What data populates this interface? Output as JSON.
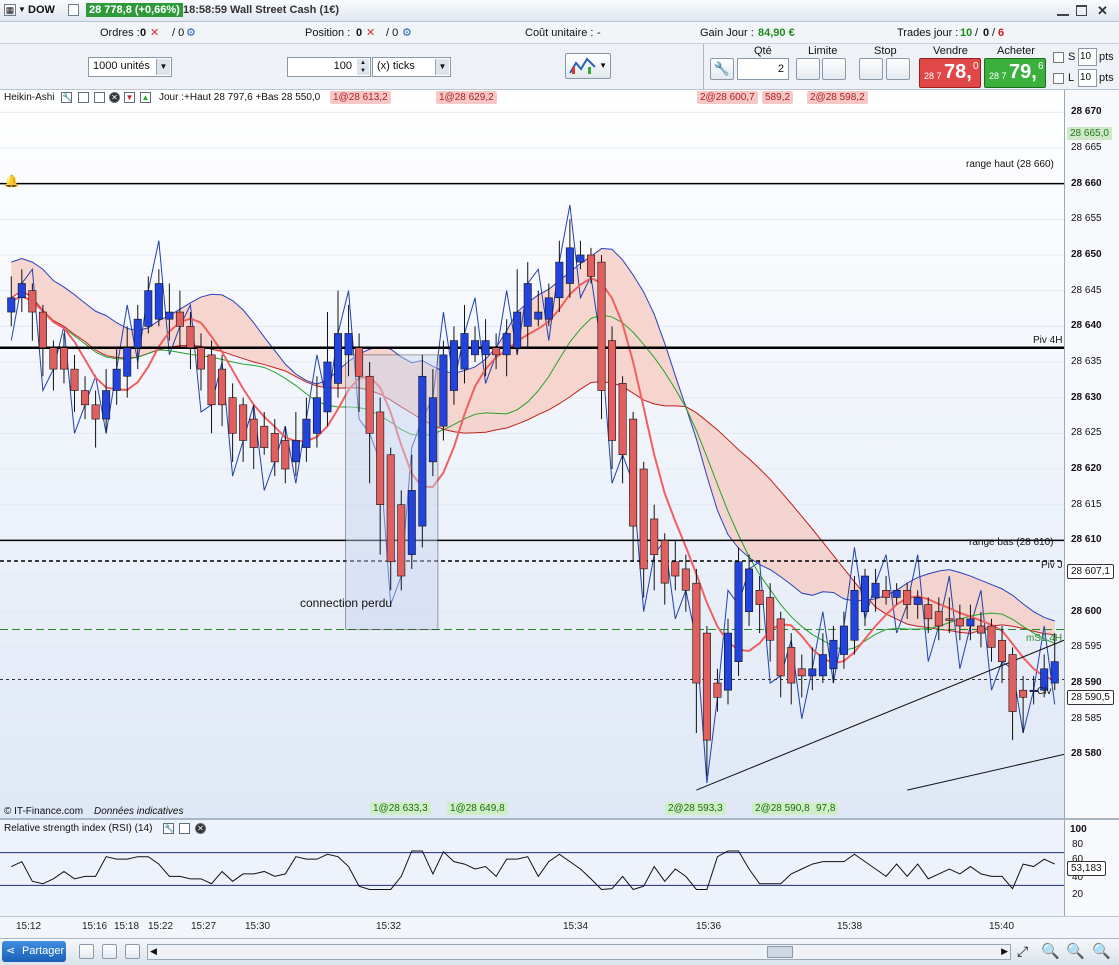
{
  "titlebar": {
    "instrument": "DOW",
    "price_badge": "28 778,8 (+0,66%)",
    "time": "18:58:59",
    "description": "Wall Street Cash (1€)"
  },
  "infobar": {
    "orders_label": "Ordres :",
    "orders_value": "0",
    "orders_value2": "/ 0",
    "position_label": "Position :",
    "position_value": "0",
    "position_value2": "/ 0",
    "unit_cost_label": "Coût unitaire :",
    "unit_cost_value": "-",
    "gain_label": "Gain Jour :",
    "gain_value": "84,90 €",
    "trades_label": "Trades jour :",
    "trades_value_green": "10",
    "trades_sep1": "/",
    "trades_value_mid": "0",
    "trades_sep2": "/",
    "trades_value_red": "6"
  },
  "toolbar": {
    "units_select": "1000 unités",
    "qty_input": "100",
    "ticks_select": "(x) ticks",
    "col_qty": "Qté",
    "qty_value": "2",
    "col_limit": "Limite",
    "col_stop": "Stop",
    "col_sell": "Vendre",
    "col_buy": "Acheter",
    "sell_prefix": "28 7",
    "sell_big": "78,",
    "sell_sup": "0",
    "buy_prefix": "28 7",
    "buy_big": "79,",
    "buy_sup": "6",
    "s_label": "S",
    "l_label": "L",
    "pts_value": "10",
    "pts_label": "pts"
  },
  "chart": {
    "indicator_name": "Heikin-Ashi",
    "day_info": "Jour :+Haut 28 797,6 +Bas 28 550,0",
    "top_tags": [
      "1@28 613,2",
      "1@28 629,2",
      "2@28 600,7",
      "589,2",
      "2@28 598,2"
    ],
    "bottom_tags": [
      "1@28 633,3",
      "1@28 649,8",
      "2@28 593,3",
      "2@28 590,8",
      "97,8"
    ],
    "line_labels": {
      "range_haut": "range haut (28 660)",
      "range_bas": "range bas (28 610)",
      "piv4h": "Piv 4H",
      "piv_j": "Piv J",
      "ms1": "mS1 4H",
      "clv": "Clv"
    },
    "annotation": "connection perdu",
    "footer": "© IT-Finance.com",
    "footer_italic": "Données indicatives",
    "price_box_top": "28 665,0",
    "price_box_piv": "28 607,1",
    "price_box_last": "28 590,5",
    "y_ticks": [
      "28 670",
      "28 665",
      "28 660",
      "28 655",
      "28 650",
      "28 645",
      "28 640",
      "28 635",
      "28 630",
      "28 625",
      "28 620",
      "28 615",
      "28 610",
      "28 605",
      "28 600",
      "28 595",
      "28 590",
      "28 585",
      "28 580"
    ]
  },
  "chart_data": {
    "type": "candlestick",
    "ylim": [
      28576,
      28672
    ],
    "candles": [
      {
        "o": 28642,
        "c": 28644,
        "h": 28647,
        "l": 28640,
        "up": true
      },
      {
        "o": 28644,
        "c": 28646,
        "h": 28648,
        "l": 28642,
        "up": true
      },
      {
        "o": 28645,
        "c": 28642,
        "h": 28646,
        "l": 28638,
        "up": false
      },
      {
        "o": 28642,
        "c": 28637,
        "h": 28643,
        "l": 28633,
        "up": false
      },
      {
        "o": 28637,
        "c": 28634,
        "h": 28638,
        "l": 28631,
        "up": false
      },
      {
        "o": 28637,
        "c": 28634,
        "h": 28639,
        "l": 28632,
        "up": false
      },
      {
        "o": 28634,
        "c": 28631,
        "h": 28636,
        "l": 28628,
        "up": false
      },
      {
        "o": 28631,
        "c": 28629,
        "h": 28633,
        "l": 28627,
        "up": false
      },
      {
        "o": 28629,
        "c": 28627,
        "h": 28631,
        "l": 28623,
        "up": false
      },
      {
        "o": 28627,
        "c": 28631,
        "h": 28634,
        "l": 28625,
        "up": true
      },
      {
        "o": 28631,
        "c": 28634,
        "h": 28637,
        "l": 28629,
        "up": true
      },
      {
        "o": 28633,
        "c": 28637,
        "h": 28640,
        "l": 28630,
        "up": true
      },
      {
        "o": 28637,
        "c": 28641,
        "h": 28643,
        "l": 28634,
        "up": true
      },
      {
        "o": 28640,
        "c": 28645,
        "h": 28647,
        "l": 28639,
        "up": true
      },
      {
        "o": 28641,
        "c": 28646,
        "h": 28648,
        "l": 28640,
        "up": true
      },
      {
        "o": 28641,
        "c": 28642,
        "h": 28646,
        "l": 28638,
        "up": true
      },
      {
        "o": 28642,
        "c": 28640,
        "h": 28645,
        "l": 28637,
        "up": false
      },
      {
        "o": 28640,
        "c": 28637,
        "h": 28642,
        "l": 28634,
        "up": false
      },
      {
        "o": 28637,
        "c": 28634,
        "h": 28639,
        "l": 28631,
        "up": false
      },
      {
        "o": 28636,
        "c": 28629,
        "h": 28638,
        "l": 28625,
        "up": false
      },
      {
        "o": 28634,
        "c": 28629,
        "h": 28636,
        "l": 28626,
        "up": false
      },
      {
        "o": 28630,
        "c": 28625,
        "h": 28632,
        "l": 28621,
        "up": false
      },
      {
        "o": 28629,
        "c": 28624,
        "h": 28630,
        "l": 28621,
        "up": false
      },
      {
        "o": 28627,
        "c": 28623,
        "h": 28629,
        "l": 28620,
        "up": false
      },
      {
        "o": 28626,
        "c": 28623,
        "h": 28628,
        "l": 28622,
        "up": false
      },
      {
        "o": 28625,
        "c": 28621,
        "h": 28627,
        "l": 28619,
        "up": false
      },
      {
        "o": 28624,
        "c": 28620,
        "h": 28626,
        "l": 28618,
        "up": false
      },
      {
        "o": 28621,
        "c": 28624,
        "h": 28628,
        "l": 28619,
        "up": true
      },
      {
        "o": 28623,
        "c": 28627,
        "h": 28630,
        "l": 28621,
        "up": true
      },
      {
        "o": 28625,
        "c": 28630,
        "h": 28633,
        "l": 28623,
        "up": true
      },
      {
        "o": 28628,
        "c": 28635,
        "h": 28642,
        "l": 28626,
        "up": true
      },
      {
        "o": 28632,
        "c": 28639,
        "h": 28645,
        "l": 28630,
        "up": true
      },
      {
        "o": 28636,
        "c": 28639,
        "h": 28643,
        "l": 28633,
        "up": true
      },
      {
        "o": 28637,
        "c": 28633,
        "h": 28639,
        "l": 28628,
        "up": false
      },
      {
        "o": 28633,
        "c": 28625,
        "h": 28635,
        "l": 28618,
        "up": false
      },
      {
        "o": 28628,
        "c": 28615,
        "h": 28630,
        "l": 28608,
        "up": false
      },
      {
        "o": 28622,
        "c": 28607,
        "h": 28623,
        "l": 28603,
        "up": false
      },
      {
        "o": 28615,
        "c": 28605,
        "h": 28617,
        "l": 28603,
        "up": false
      },
      {
        "o": 28608,
        "c": 28617,
        "h": 28622,
        "l": 28606,
        "up": true
      },
      {
        "o": 28612,
        "c": 28633,
        "h": 28636,
        "l": 28609,
        "up": true
      },
      {
        "o": 28621,
        "c": 28630,
        "h": 28634,
        "l": 28619,
        "up": true
      },
      {
        "o": 28626,
        "c": 28636,
        "h": 28638,
        "l": 28624,
        "up": true
      },
      {
        "o": 28631,
        "c": 28638,
        "h": 28640,
        "l": 28629,
        "up": true
      },
      {
        "o": 28634,
        "c": 28639,
        "h": 28643,
        "l": 28632,
        "up": true
      },
      {
        "o": 28636,
        "c": 28638,
        "h": 28640,
        "l": 28635,
        "up": true
      },
      {
        "o": 28636,
        "c": 28638,
        "h": 28641,
        "l": 28633,
        "up": true
      },
      {
        "o": 28637,
        "c": 28636,
        "h": 28639,
        "l": 28634,
        "up": false
      },
      {
        "o": 28636,
        "c": 28639,
        "h": 28641,
        "l": 28633,
        "up": true
      },
      {
        "o": 28637,
        "c": 28642,
        "h": 28648,
        "l": 28636,
        "up": true
      },
      {
        "o": 28640,
        "c": 28646,
        "h": 28649,
        "l": 28637,
        "up": true
      },
      {
        "o": 28641,
        "c": 28642,
        "h": 28645,
        "l": 28640,
        "up": true
      },
      {
        "o": 28641,
        "c": 28644,
        "h": 28646,
        "l": 28640,
        "up": true
      },
      {
        "o": 28644,
        "c": 28649,
        "h": 28652,
        "l": 28642,
        "up": true
      },
      {
        "o": 28646,
        "c": 28651,
        "h": 28655,
        "l": 28644,
        "up": true
      },
      {
        "o": 28649,
        "c": 28650,
        "h": 28652,
        "l": 28648,
        "up": true
      },
      {
        "o": 28650,
        "c": 28647,
        "h": 28651,
        "l": 28646,
        "up": false
      },
      {
        "o": 28649,
        "c": 28631,
        "h": 28650,
        "l": 28627,
        "up": false
      },
      {
        "o": 28638,
        "c": 28624,
        "h": 28640,
        "l": 28620,
        "up": false
      },
      {
        "o": 28632,
        "c": 28622,
        "h": 28633,
        "l": 28618,
        "up": false
      },
      {
        "o": 28627,
        "c": 28612,
        "h": 28628,
        "l": 28607,
        "up": false
      },
      {
        "o": 28620,
        "c": 28606,
        "h": 28621,
        "l": 28602,
        "up": false
      },
      {
        "o": 28613,
        "c": 28608,
        "h": 28615,
        "l": 28603,
        "up": false
      },
      {
        "o": 28610,
        "c": 28604,
        "h": 28611,
        "l": 28601,
        "up": false
      },
      {
        "o": 28607,
        "c": 28605,
        "h": 28610,
        "l": 28603,
        "up": false
      },
      {
        "o": 28606,
        "c": 28603,
        "h": 28608,
        "l": 28600,
        "up": false
      },
      {
        "o": 28604,
        "c": 28590,
        "h": 28606,
        "l": 28583,
        "up": false
      },
      {
        "o": 28597,
        "c": 28582,
        "h": 28598,
        "l": 28577,
        "up": false
      },
      {
        "o": 28590,
        "c": 28588,
        "h": 28592,
        "l": 28586,
        "up": false
      },
      {
        "o": 28589,
        "c": 28597,
        "h": 28599,
        "l": 28587,
        "up": true
      },
      {
        "o": 28593,
        "c": 28607,
        "h": 28609,
        "l": 28591,
        "up": true
      },
      {
        "o": 28600,
        "c": 28606,
        "h": 28608,
        "l": 28598,
        "up": true
      },
      {
        "o": 28603,
        "c": 28601,
        "h": 28605,
        "l": 28597,
        "up": false
      },
      {
        "o": 28602,
        "c": 28596,
        "h": 28604,
        "l": 28593,
        "up": false
      },
      {
        "o": 28599,
        "c": 28591,
        "h": 28600,
        "l": 28588,
        "up": false
      },
      {
        "o": 28595,
        "c": 28590,
        "h": 28597,
        "l": 28587,
        "up": false
      },
      {
        "o": 28592,
        "c": 28591,
        "h": 28594,
        "l": 28588,
        "up": false
      },
      {
        "o": 28591,
        "c": 28592,
        "h": 28595,
        "l": 28589,
        "up": true
      },
      {
        "o": 28591,
        "c": 28594,
        "h": 28597,
        "l": 28590,
        "up": true
      },
      {
        "o": 28592,
        "c": 28596,
        "h": 28598,
        "l": 28590,
        "up": true
      },
      {
        "o": 28594,
        "c": 28598,
        "h": 28600,
        "l": 28592,
        "up": true
      },
      {
        "o": 28596,
        "c": 28603,
        "h": 28605,
        "l": 28594,
        "up": true
      },
      {
        "o": 28600,
        "c": 28605,
        "h": 28606,
        "l": 28598,
        "up": true
      },
      {
        "o": 28602,
        "c": 28604,
        "h": 28606,
        "l": 28600,
        "up": true
      },
      {
        "o": 28603,
        "c": 28602,
        "h": 28605,
        "l": 28601,
        "up": false
      },
      {
        "o": 28602,
        "c": 28603,
        "h": 28604,
        "l": 28601,
        "up": true
      },
      {
        "o": 28603,
        "c": 28601,
        "h": 28604,
        "l": 28599,
        "up": false
      },
      {
        "o": 28601,
        "c": 28602,
        "h": 28603,
        "l": 28599,
        "up": true
      },
      {
        "o": 28601,
        "c": 28599,
        "h": 28602,
        "l": 28597,
        "up": false
      },
      {
        "o": 28600,
        "c": 28598,
        "h": 28602,
        "l": 28596,
        "up": false
      },
      {
        "o": 28599,
        "c": 28599,
        "h": 28602,
        "l": 28597,
        "up": false
      },
      {
        "o": 28599,
        "c": 28598,
        "h": 28601,
        "l": 28596,
        "up": false
      },
      {
        "o": 28599,
        "c": 28598,
        "h": 28601,
        "l": 28596,
        "up": true
      },
      {
        "o": 28598,
        "c": 28597,
        "h": 28600,
        "l": 28595,
        "up": false
      },
      {
        "o": 28598,
        "c": 28595,
        "h": 28599,
        "l": 28593,
        "up": false
      },
      {
        "o": 28596,
        "c": 28593,
        "h": 28598,
        "l": 28590,
        "up": false
      },
      {
        "o": 28594,
        "c": 28586,
        "h": 28595,
        "l": 28582,
        "up": false
      },
      {
        "o": 28588,
        "c": 28589,
        "h": 28591,
        "l": 28583,
        "up": false
      },
      {
        "o": 28589,
        "c": 28589,
        "h": 28591,
        "l": 28587,
        "up": true
      },
      {
        "o": 28589,
        "c": 28592,
        "h": 28594,
        "l": 28588,
        "up": true
      },
      {
        "o": 28590,
        "c": 28593,
        "h": 28597,
        "l": 28589,
        "up": true
      }
    ],
    "rsi": {
      "name": "Relative strength index (RSI) (14)",
      "ylim": [
        0,
        100
      ],
      "ticks": [
        "100",
        "80",
        "60",
        "40",
        "20"
      ],
      "last": "53,183"
    },
    "time_labels": [
      "15:12",
      "15:16",
      "15:18",
      "15:22",
      "15:27",
      "15:30",
      "15:32",
      "15:34",
      "15:36",
      "15:38",
      "15:40"
    ]
  },
  "bottombar": {
    "share_label": "Partager"
  },
  "colors": {
    "up": "#2244dd",
    "down": "#e06060",
    "cloud_red": "#f5c9bf",
    "cloud_blue": "#aee0f5",
    "sell_bg": "#e04848",
    "buy_bg": "#3cb03c"
  }
}
